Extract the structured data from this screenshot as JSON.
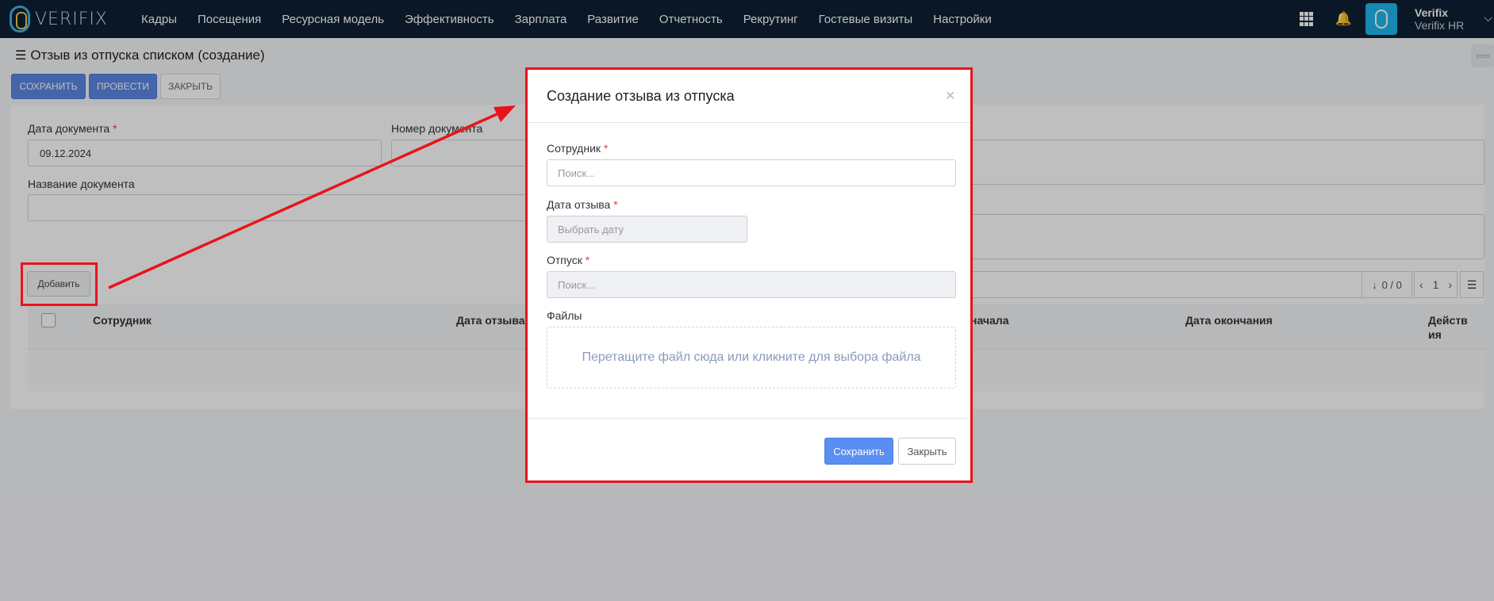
{
  "app": {
    "logo": "VERIFIX"
  },
  "nav": [
    "Кадры",
    "Посещения",
    "Ресурсная модель",
    "Эффективность",
    "Зарплата",
    "Развитие",
    "Отчетность",
    "Рекрутинг",
    "Гостевые визиты",
    "Настройки"
  ],
  "user": {
    "name": "Verifix",
    "company": "Verifix HR"
  },
  "page": {
    "title": "Отзыв из отпуска списком (создание)",
    "buttons": {
      "save": "СОХРАНИТЬ",
      "post": "ПРОВЕСТИ",
      "close": "ЗАКРЫТЬ"
    }
  },
  "form": {
    "doc_date_label": "Дата документа",
    "doc_date_value": "09.12.2024",
    "doc_number_label": "Номер документа",
    "doc_name_label": "Название документа",
    "add_button": "Добавить",
    "pager_count": "0 / 0",
    "pager_page": "1"
  },
  "table": {
    "columns": [
      "Сотрудник",
      "Дата отзыва",
      "начала",
      "Дата окончания",
      "Действия"
    ]
  },
  "modal": {
    "title": "Создание отзыва из отпуска",
    "employee_label": "Сотрудник",
    "employee_placeholder": "Поиск...",
    "recall_date_label": "Дата отзыва",
    "recall_date_placeholder": "Выбрать дату",
    "vacation_label": "Отпуск",
    "vacation_placeholder": "Поиск...",
    "files_label": "Файлы",
    "dropzone_text": "Перетащите файл сюда или кликните для выбора файла",
    "save_button": "Сохранить",
    "close_button": "Закрыть",
    "required_mark": "*"
  },
  "colors": {
    "annotation": "#e8141a",
    "primary": "#5b87e3",
    "topbar": "#0d1f33"
  }
}
